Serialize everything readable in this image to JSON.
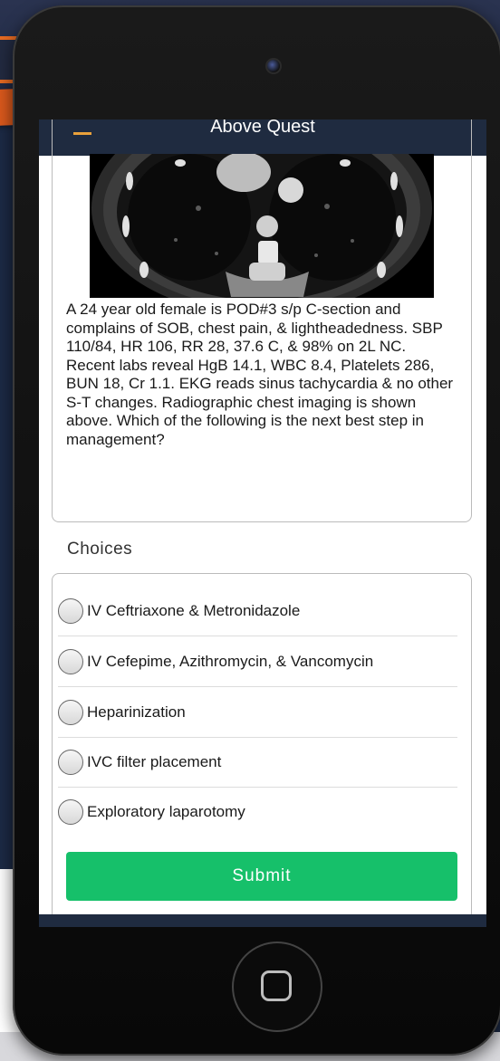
{
  "app": {
    "title": "Above Quest"
  },
  "question": {
    "image_alt": "CT chest image",
    "text": "A 24 year old female is POD#3 s/p C-section and complains of SOB, chest pain, & lightheadedness. SBP 110/84, HR 106, RR 28, 37.6 C, & 98% on 2L NC. Recent labs reveal HgB 14.1, WBC 8.4, Platelets 286, BUN 18, Cr 1.1. EKG reads sinus tachycardia & no other S-T changes. Radiographic chest imaging is shown above. Which of the following is the next best step in management?"
  },
  "choices": {
    "heading": "Choices",
    "items": [
      {
        "label": "IV Ceftriaxone & Metronidazole",
        "selected": false
      },
      {
        "label": "IV Cefepime, Azithromycin, & Vancomycin",
        "selected": false
      },
      {
        "label": "Heparinization",
        "selected": false
      },
      {
        "label": "IVC filter placement",
        "selected": false
      },
      {
        "label": "Exploratory laparotomy",
        "selected": false
      }
    ]
  },
  "actions": {
    "submit_label": "Submit"
  },
  "colors": {
    "header": "#1f2b40",
    "submit": "#16c06a",
    "accent_orange": "#e56a22"
  }
}
